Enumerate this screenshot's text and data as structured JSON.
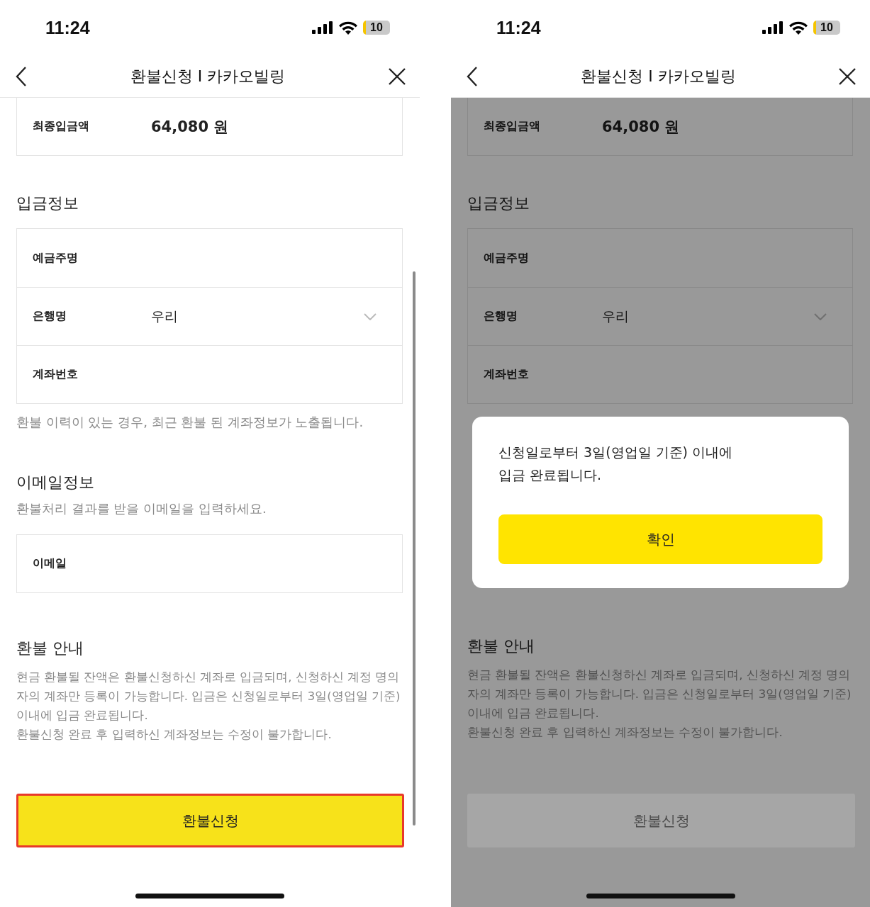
{
  "screens": [
    {
      "status_bar": {
        "time": "11:24",
        "battery": "10"
      },
      "header": {
        "title": "환불신청 I 카카오빌링"
      },
      "amount_row": {
        "label": "최종입금액",
        "value": "64,080 원"
      },
      "deposit_section": {
        "title": "입금정보",
        "fields": [
          {
            "label": "예금주명",
            "kind": "text"
          },
          {
            "label": "은행명",
            "kind": "select",
            "value": "우리"
          },
          {
            "label": "계좌번호",
            "kind": "text"
          }
        ],
        "note": "환불 이력이 있는 경우, 최근 환불 된 계좌정보가 노출됩니다."
      },
      "email_section": {
        "title": "이메일정보",
        "subtitle": "환불처리 결과를 받을 이메일을 입력하세요.",
        "field": {
          "label": "이메일"
        }
      },
      "guide": {
        "title": "환불 안내",
        "paragraphs": [
          "현금 환불될 잔액은 환불신청하신 계좌로 입금되며, 신청하신 계정 명의자의 계좌만 등록이 가능합니다. 입금은 신청일로부터 3일(영업일 기준) 이내에 입금 완료됩니다.",
          "환불신청 완료 후 입력하신 계좌정보는 수정이 불가합니다."
        ]
      },
      "submit_button": {
        "label": "환불신청",
        "disabled": false,
        "highlighted": true
      }
    },
    {
      "status_bar": {
        "time": "11:24",
        "battery": "10"
      },
      "header": {
        "title": "환불신청 I 카카오빌링"
      },
      "amount_row": {
        "label": "최종입금액",
        "value": "64,080 원"
      },
      "deposit_section": {
        "title": "입금정보",
        "fields": [
          {
            "label": "예금주명",
            "kind": "text"
          },
          {
            "label": "은행명",
            "kind": "select",
            "value": "우리"
          },
          {
            "label": "계좌번호",
            "kind": "text"
          }
        ]
      },
      "guide": {
        "title": "환불 안내",
        "paragraphs": [
          "현금 환불될 잔액은 환불신청하신 계좌로 입금되며, 신청하신 계정 명의자의 계좌만 등록이 가능합니다. 입금은 신청일로부터 3일(영업일 기준) 이내에 입금 완료됩니다.",
          "환불신청 완료 후 입력하신 계좌정보는 수정이 불가합니다."
        ]
      },
      "submit_button": {
        "label": "환불신청",
        "disabled": true,
        "highlighted": false
      },
      "dialog": {
        "message": "신청일로부터 3일(영업일 기준) 이내에\n입금 완료됩니다.",
        "button": "확인"
      }
    }
  ]
}
